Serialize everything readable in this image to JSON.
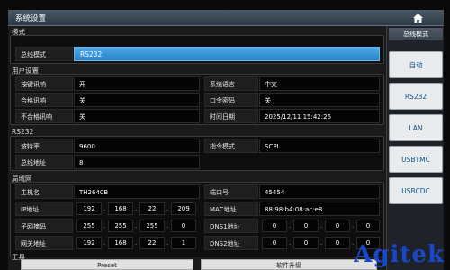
{
  "window": {
    "title": "系统设置"
  },
  "sections": {
    "mode": "模式",
    "user": "用户设置",
    "rs232": "RS232",
    "lan": "局域网",
    "tools": "工具"
  },
  "mode": {
    "label": "总线模式",
    "value": "RS232"
  },
  "user": {
    "key_beep_label": "按键讯响",
    "key_beep_value": "开",
    "language_label": "系统语言",
    "language_value": "中文",
    "pass_beep_label": "合格讯响",
    "pass_beep_value": "关",
    "password_label": "口令密码",
    "password_value": "关",
    "fail_beep_label": "不合格讯响",
    "fail_beep_value": "关",
    "datetime_label": "时间日期",
    "datetime_value": "2025/12/11 15:42:26"
  },
  "rs232": {
    "baud_label": "波特率",
    "baud_value": "9600",
    "cmd_label": "指令模式",
    "cmd_value": "SCPI",
    "addr_label": "总线地址",
    "addr_value": "8"
  },
  "lan": {
    "host_label": "主机名",
    "host_value": "TH2640B",
    "port_label": "端口号",
    "port_value": "45454",
    "ip_label": "IP地址",
    "ip": [
      "192",
      "168",
      "22",
      "209"
    ],
    "mac_label": "MAC地址",
    "mac_value": "88:98:b4:08:ac:e8",
    "mask_label": "子网掩码",
    "mask": [
      "255",
      "255",
      "255",
      "0"
    ],
    "dns1_label": "DNS1地址",
    "dns1": [
      "0",
      "0",
      "0",
      "0"
    ],
    "gw_label": "网关地址",
    "gw": [
      "192",
      "168",
      "22",
      "1"
    ],
    "dns2_label": "DNS2地址",
    "dns2": [
      "0",
      "0",
      "0",
      "0"
    ]
  },
  "tools": {
    "preset": "Preset",
    "upgrade": "软件升级"
  },
  "sidebar": {
    "header": "总线模式",
    "items": [
      "自动",
      "RS232",
      "LAN",
      "USBTMC",
      "USBCDC"
    ]
  },
  "watermark": "Agitek",
  "colors": {
    "accent": "#3a96dc",
    "sidebar_text": "#15507f",
    "watermark": "#1848c8"
  },
  "icons": {
    "home": "home-icon"
  }
}
